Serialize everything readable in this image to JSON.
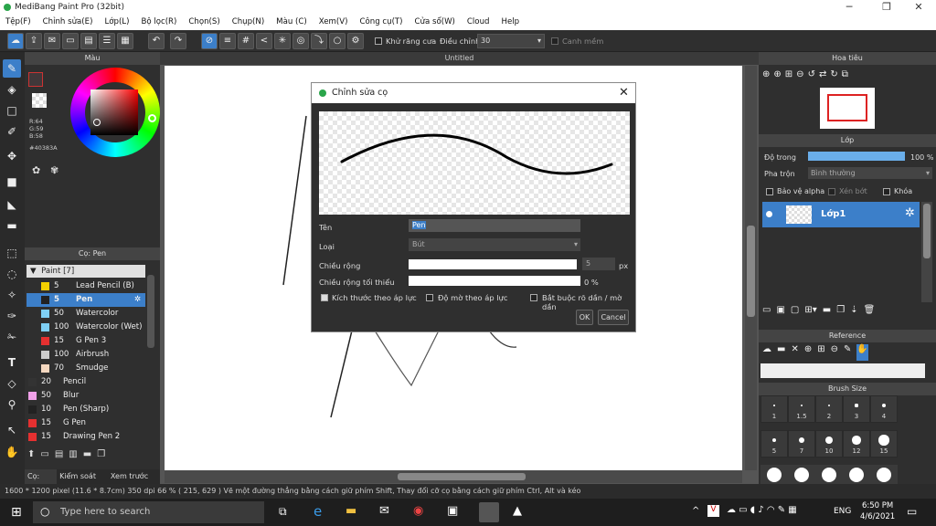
{
  "app": {
    "title": "MediBang Paint Pro (32bit)"
  },
  "window_controls": {
    "minimize": "─",
    "maximize": "❐",
    "close": "✕"
  },
  "menu": [
    "Tệp(F)",
    "Chỉnh sửa(E)",
    "Lớp(L)",
    "Bộ lọc(R)",
    "Chọn(S)",
    "Chụp(N)",
    "Màu (C)",
    "Xem(V)",
    "Công cụ(T)",
    "Cửa sổ(W)",
    "Cloud",
    "Help"
  ],
  "toolbar": {
    "antialias_label": "Khử răng cưa",
    "correction_label": "Điều chỉnh",
    "correction_value": "30",
    "snap_label": "Canh mềm"
  },
  "color_panel": {
    "title": "Màu",
    "rgb_r": "R:64",
    "rgb_g": "G:59",
    "rgb_b": "B:58",
    "hex": "#40383A",
    "primary_color": "#40383A"
  },
  "brush_panel": {
    "title": "Cọ: Pen",
    "group": "Paint [7]",
    "items": [
      {
        "size": "5",
        "name": "Lead Pencil (B)",
        "color": "#f5d000"
      },
      {
        "size": "5",
        "name": "Pen",
        "color": "#222222"
      },
      {
        "size": "50",
        "name": "Watercolor",
        "color": "#7fd0f5"
      },
      {
        "size": "100",
        "name": "Watercolor (Wet)",
        "color": "#7fd0f5"
      },
      {
        "size": "15",
        "name": "G Pen 3",
        "color": "#e53030"
      },
      {
        "size": "100",
        "name": "Airbrush",
        "color": "#cccccc"
      },
      {
        "size": "70",
        "name": "Smudge",
        "color": "#f5d8c0"
      },
      {
        "size": "20",
        "name": "Pencil",
        "color": "#333333"
      },
      {
        "size": "50",
        "name": "Blur",
        "color": "#f0a0e8"
      },
      {
        "size": "10",
        "name": "Pen (Sharp)",
        "color": "#222222"
      },
      {
        "size": "15",
        "name": "G Pen",
        "color": "#e53030"
      },
      {
        "size": "15",
        "name": "Drawing Pen 2",
        "color": "#e53030"
      }
    ],
    "tabs": [
      "Cọ: Pen",
      "Kiểm soát cọ",
      "Xem trước cọ"
    ]
  },
  "canvas": {
    "tab_title": "Untitled"
  },
  "navigator": {
    "title": "Hoa tiêu"
  },
  "layer_panel": {
    "title": "Lớp",
    "opacity_label": "Độ trong",
    "opacity_value": "100 %",
    "opacity_fraction": 1.0,
    "blend_label": "Pha trộn",
    "blend_value": "Bình thường",
    "protect_alpha": "Bảo vệ alpha",
    "clip": "Xén bớt",
    "lock": "Khóa",
    "layer_name": "Lớp1"
  },
  "reference_panel": {
    "title": "Reference"
  },
  "brush_size_panel": {
    "title": "Brush Size",
    "sizes_row1": [
      "1",
      "1.5",
      "2",
      "3",
      "4"
    ],
    "sizes_row2": [
      "5",
      "7",
      "10",
      "12",
      "15"
    ]
  },
  "dialog": {
    "title": "Chỉnh sửa cọ",
    "name_label": "Tên",
    "name_value": "Pen",
    "type_label": "Loại",
    "type_value": "Bút",
    "width_label": "Chiều rộng",
    "width_value": "5",
    "width_unit": "px",
    "min_width_label": "Chiều rộng tối thiểu",
    "min_width_value": "0 %",
    "pressure_size": "Kích thước theo áp lực",
    "pressure_opacity": "Độ mờ theo áp lực",
    "force_fade": "Bắt buộc rõ dần / mờ dần",
    "ok": "OK",
    "cancel": "Cancel"
  },
  "status": {
    "text": "1600 * 1200 pixel   (11.6 * 8.7cm)   350 dpi   66 %   ( 215, 629 )   Vẽ một đường thẳng bằng cách giữ phím Shift, Thay đổi cỡ cọ bằng cách giữ phím Ctrl, Alt và kéo"
  },
  "taskbar": {
    "search_placeholder": "Type here to search",
    "time": "6:50 PM",
    "date": "4/6/2021",
    "lang": "ENG"
  }
}
